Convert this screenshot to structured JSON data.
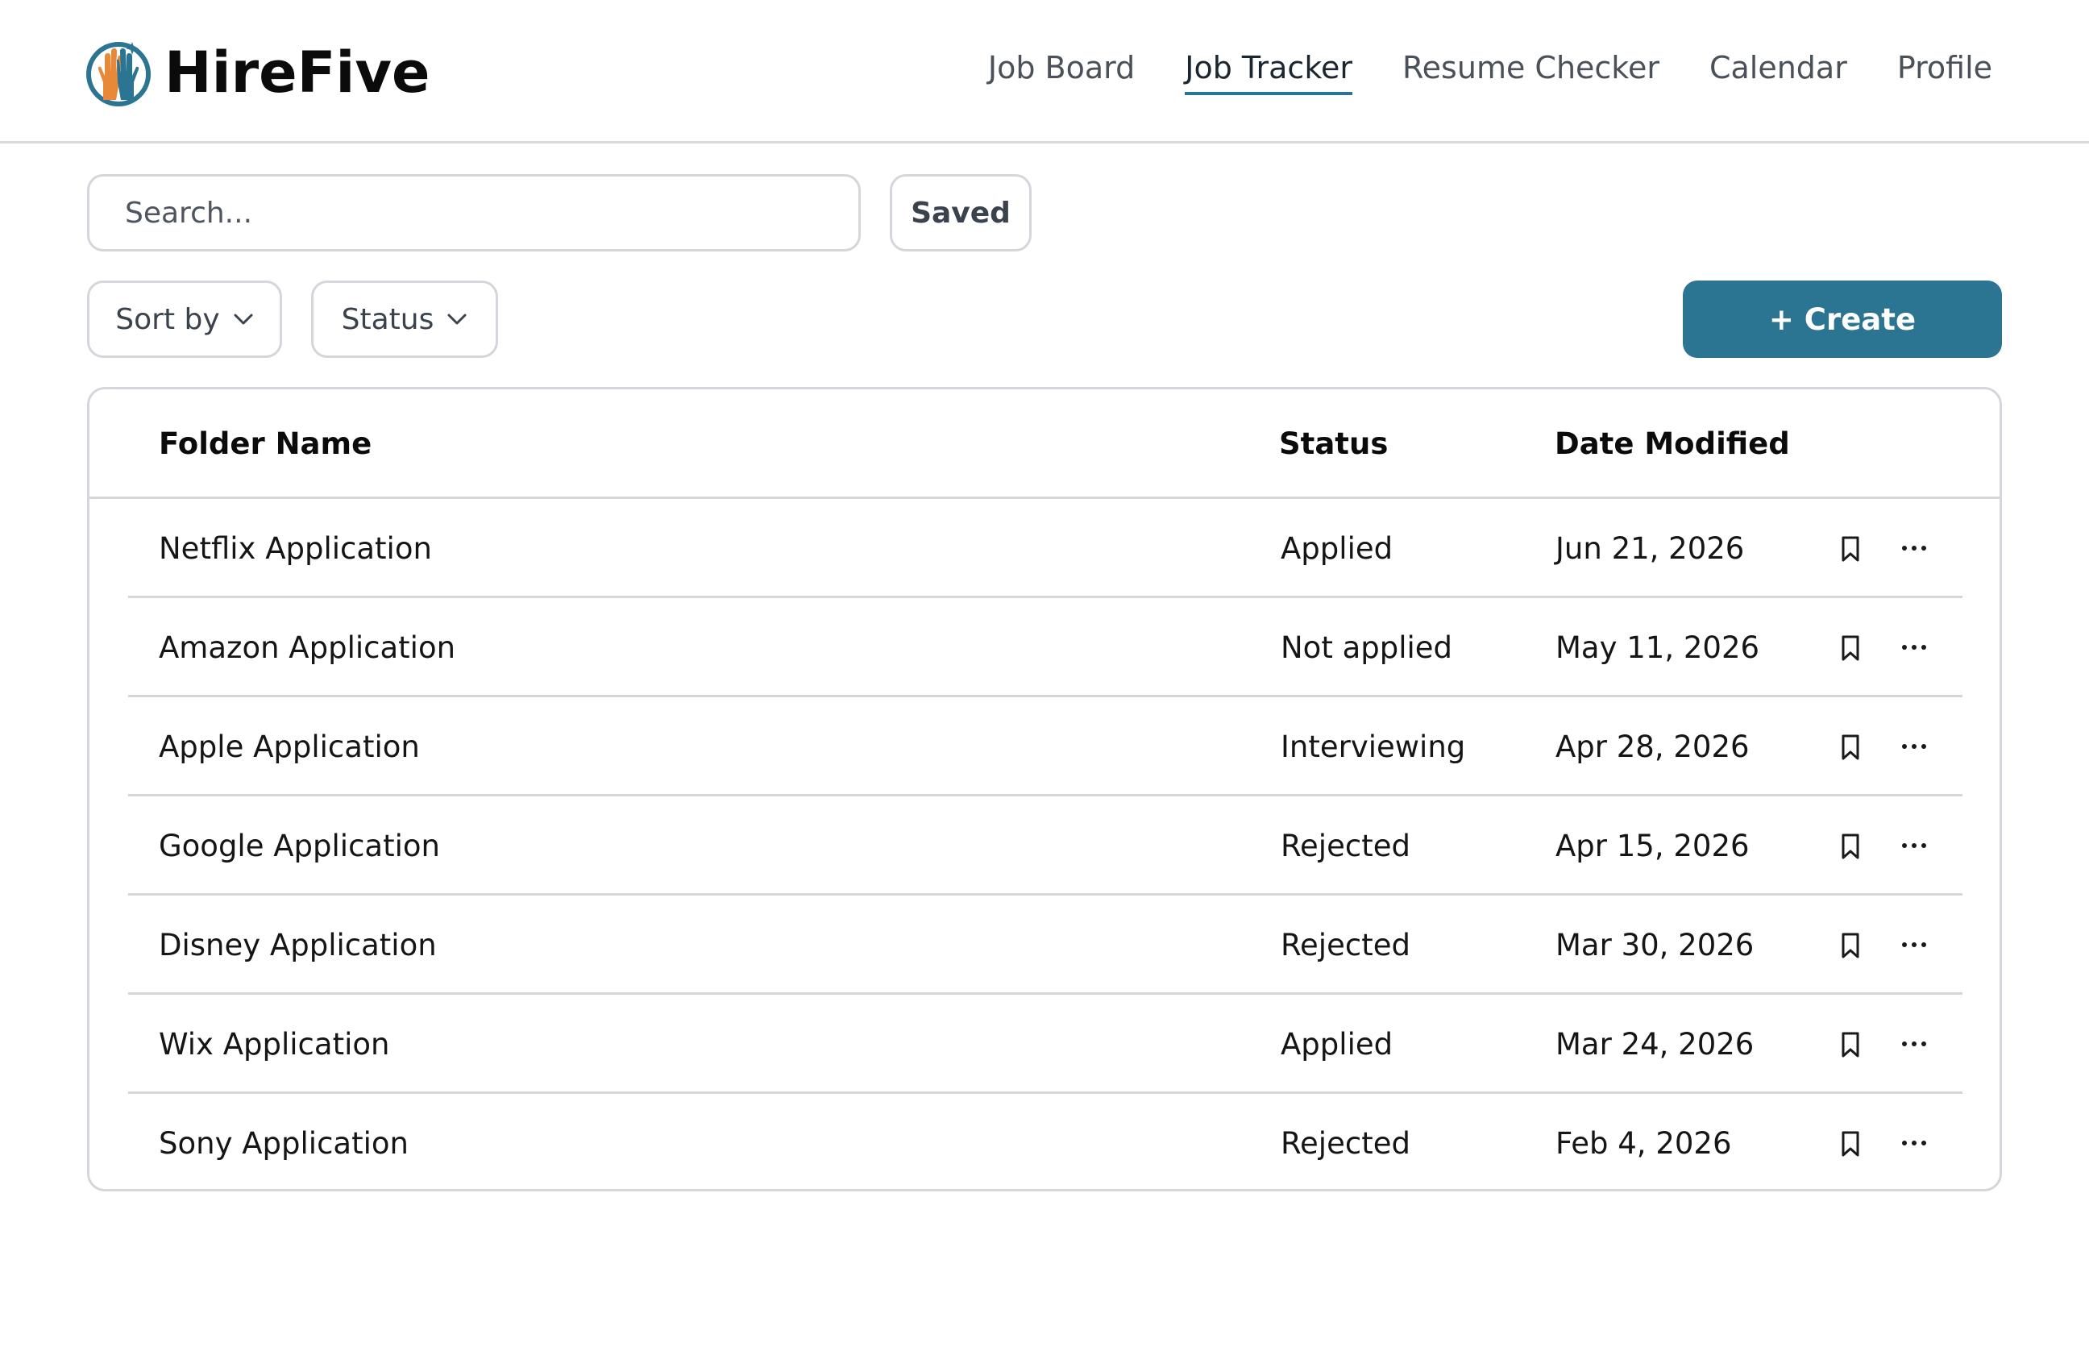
{
  "brand": {
    "name": "HireFive",
    "logo_icon": "raised-hands-logo-icon",
    "colors": {
      "orange": "#e8893a",
      "teal": "#2b7592"
    }
  },
  "nav": {
    "items": [
      {
        "label": "Job Board"
      },
      {
        "label": "Job Tracker",
        "active": true
      },
      {
        "label": "Resume Checker"
      },
      {
        "label": "Calendar"
      },
      {
        "label": "Profile"
      }
    ]
  },
  "toolbar": {
    "search_placeholder": "Search...",
    "saved_label": "Saved",
    "sort_label": "Sort by",
    "status_label": "Status",
    "create_label": "+ Create",
    "accent_color": "#2b7592"
  },
  "table": {
    "headers": {
      "name": "Folder Name",
      "status": "Status",
      "date": "Date Modified"
    },
    "rows": [
      {
        "name": "Netflix Application",
        "status": "Applied",
        "date": "Jun 21, 2026"
      },
      {
        "name": "Amazon Application",
        "status": "Not applied",
        "date": "May 11, 2026"
      },
      {
        "name": "Apple Application",
        "status": "Interviewing",
        "date": "Apr 28, 2026"
      },
      {
        "name": "Google Application",
        "status": "Rejected",
        "date": "Apr 15, 2026"
      },
      {
        "name": "Disney Application",
        "status": "Rejected",
        "date": "Mar 30, 2026"
      },
      {
        "name": "Wix Application",
        "status": "Applied",
        "date": "Mar 24, 2026"
      },
      {
        "name": "Sony Application",
        "status": "Rejected",
        "date": "Feb 4, 2026"
      }
    ]
  }
}
